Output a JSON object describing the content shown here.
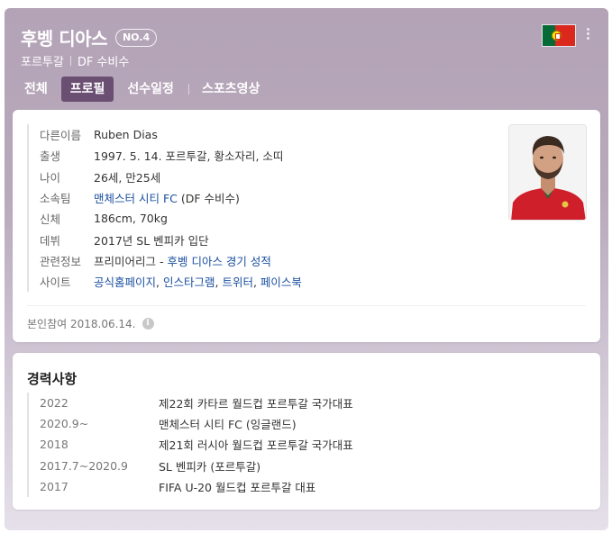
{
  "header": {
    "player_name": "후벵 디아스",
    "number_badge": "NO.4",
    "country": "포르투갈",
    "position": "DF 수비수",
    "flag_name": "portugal-flag"
  },
  "tabs": [
    {
      "label": "전체",
      "active": false
    },
    {
      "label": "프로필",
      "active": true
    },
    {
      "label": "선수일정",
      "active": false
    },
    {
      "label": "스포츠영상",
      "active": false
    }
  ],
  "profile": {
    "rows": [
      {
        "label": "다른이름",
        "value": "Ruben Dias"
      },
      {
        "label": "출생",
        "value": "1997. 5. 14. 포르투갈, 황소자리, 소띠"
      },
      {
        "label": "나이",
        "value": "26세, 만25세"
      },
      {
        "label": "소속팀",
        "value_link": "맨체스터 시티 FC",
        "value_rest": " (DF 수비수)"
      },
      {
        "label": "신체",
        "value": "186cm, 70kg"
      },
      {
        "label": "데뷔",
        "value": "2017년 SL 벤피카 입단"
      },
      {
        "label": "관련정보",
        "value_prefix": "프리미어리그 - ",
        "value_link": "후벵 디아스 경기 성적"
      },
      {
        "label": "사이트",
        "links": [
          "공식홈페이지",
          "인스타그램",
          "트위터",
          "페이스북"
        ]
      }
    ],
    "self_reference": "본인참여 2018.06.14.",
    "photo_alt": "후벵 디아스"
  },
  "career": {
    "title": "경력사항",
    "items": [
      {
        "year": "2022",
        "desc": "제22회 카타르 월드컵 포르투갈 국가대표"
      },
      {
        "year": "2020.9~",
        "desc": "맨체스터 시티 FC (잉글랜드)"
      },
      {
        "year": "2018",
        "desc": "제21회 러시아 월드컵 포르투갈 국가대표"
      },
      {
        "year": "2017.7~2020.9",
        "desc": "SL 벤피카 (포르투갈)"
      },
      {
        "year": "2017",
        "desc": "FIFA U-20 월드컵 포르투갈 대표"
      }
    ]
  },
  "colors": {
    "header_bg": "#b4a3b7",
    "active_tab": "#6b4f73",
    "link": "#1a4fa0"
  }
}
